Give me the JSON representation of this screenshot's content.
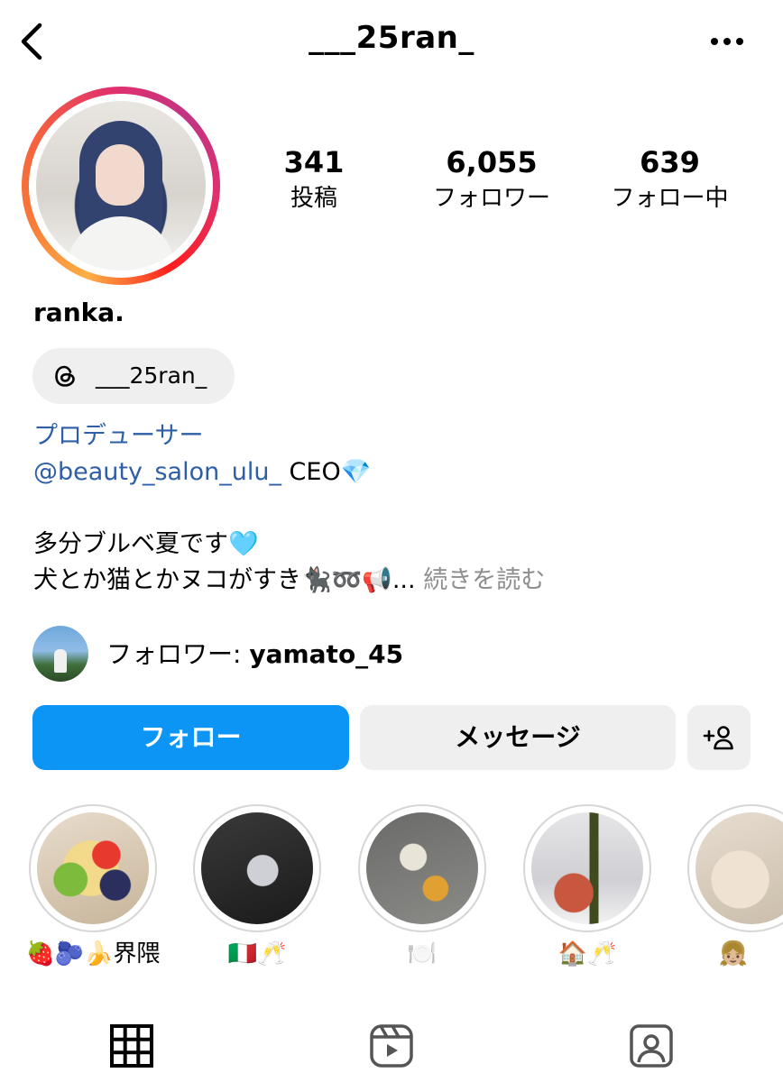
{
  "header": {
    "username": "___25ran_",
    "back_icon": "chevron-left-icon",
    "more_icon": "more-horizontal-icon"
  },
  "profile": {
    "stats": {
      "posts": {
        "value": "341",
        "label": "投稿"
      },
      "followers": {
        "value": "6,055",
        "label": "フォロワー"
      },
      "following": {
        "value": "639",
        "label": "フォロー中"
      }
    },
    "display_name": "ranka.",
    "threads_badge": {
      "icon": "threads-icon",
      "label": "___25ran_"
    },
    "category": "プロデューサー",
    "bio": {
      "mention": "@beauty_salon_ulu_",
      "line1_rest": " CEO💎",
      "line2": "多分ブルベ夏です🩵",
      "line3": "犬とか猫とかヌコがすき🐈‍⬛➿📢...",
      "more": " 続きを読む"
    },
    "mutual": {
      "prefix": "フォロワー: ",
      "name": "yamato_45"
    }
  },
  "actions": {
    "follow": "フォロー",
    "message": "メッセージ",
    "add_user_icon": "add-person-icon"
  },
  "highlights": [
    {
      "caption": "🍓🫐🍌界隈"
    },
    {
      "caption": "🇮🇹🥂"
    },
    {
      "caption": "🍽️"
    },
    {
      "caption": "🏠🥂"
    },
    {
      "caption": "👧🏼"
    }
  ],
  "tabs": [
    {
      "icon": "grid-icon"
    },
    {
      "icon": "reels-icon"
    },
    {
      "icon": "tagged-icon"
    }
  ],
  "colors": {
    "accent": "#0d95f6",
    "link": "#2d5ea6",
    "button_bg": "#efefef"
  }
}
